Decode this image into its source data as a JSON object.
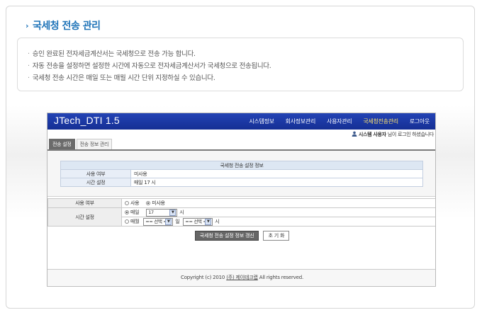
{
  "page": {
    "title": "국세청 전송 관리",
    "notes": [
      "승인 완료된 전자세금계산서는 국세청으로 전송 가능 합니다.",
      "자동 전송을 설정하면 설정한 시간에 자동으로 전자세금계산서가 국세청으로 전송됩니다.",
      "국세청 전송 시간은 매일 또는 매월 시간 단위 지정하실 수 있습니다."
    ]
  },
  "app": {
    "brand": "JTech_DTI",
    "version": "1.5",
    "nav": [
      {
        "label": "시스템정보"
      },
      {
        "label": "회사정보관리"
      },
      {
        "label": "사용자관리"
      },
      {
        "label": "국세청전송관리"
      },
      {
        "label": "로그아웃"
      }
    ],
    "user": {
      "name": "시스템 사용자",
      "suffix": "님이 로그인 하셨습니다"
    },
    "tabs": [
      {
        "label": "전송 설정"
      },
      {
        "label": "전송 정보 관리"
      }
    ],
    "info_table": {
      "header": "국세청 전송 설정 정보",
      "rows": [
        {
          "label": "사용 여부",
          "value": "미사용"
        },
        {
          "label": "시간 설정",
          "value": "매일 17 시"
        }
      ]
    },
    "form": {
      "use_label": "사용 여부",
      "use_options": [
        "사용",
        "미사용"
      ],
      "time_label": "시간 설정",
      "daily_label": "매일",
      "daily_hour": "17",
      "hour_unit": "시",
      "monthly_label": "매월",
      "monthly_day_placeholder": "== 선택 ==",
      "day_unit": "일",
      "monthly_hour_placeholder": "== 선택 =="
    },
    "buttons": {
      "save": "국세청 전송 설정 정보 갱신",
      "reset": "초 기 화"
    },
    "footer": {
      "prefix": "Copyright (c) 2010",
      "company": "(주) 제이테크랩",
      "suffix": "All rights reserved."
    }
  },
  "colors": {
    "title_blue": "#1e73b8",
    "header_blue": "#1c3aa6",
    "nav_active": "#ffe36a",
    "tab_active": "#6b6b6b"
  }
}
